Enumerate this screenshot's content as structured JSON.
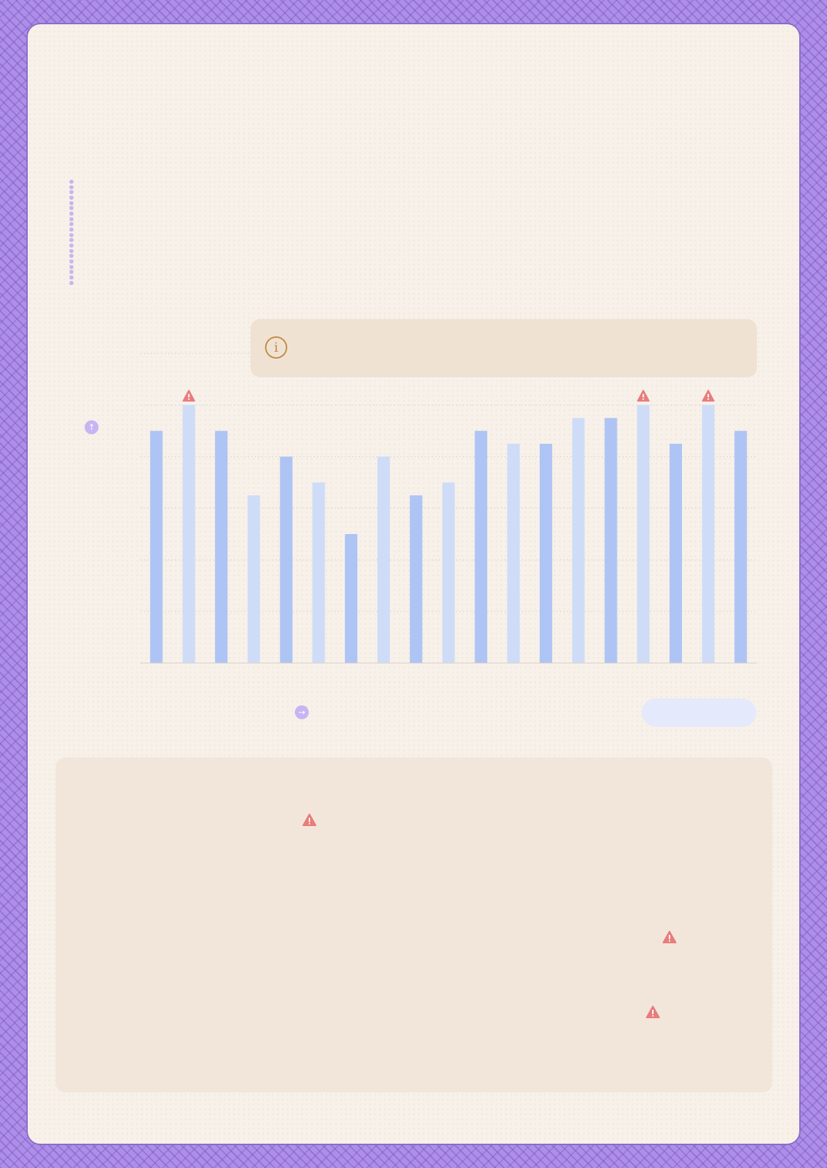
{
  "chart_data": {
    "type": "bar",
    "title": "",
    "xlabel": "",
    "ylabel": "",
    "categories": [
      "",
      "",
      "",
      "",
      "",
      "",
      "",
      "",
      "",
      "",
      "",
      "",
      "",
      "",
      "",
      "",
      "",
      "",
      ""
    ],
    "values": [
      18,
      20,
      18,
      13,
      16,
      14,
      10,
      16,
      13,
      14,
      18,
      17,
      17,
      19,
      19,
      20,
      17,
      20,
      18
    ],
    "flagged_indices": [
      1,
      15,
      17
    ],
    "ylim": [
      0,
      20
    ],
    "grid": true,
    "colors": {
      "bar_primary": "#aec4f4",
      "bar_alternate": "#cfdcf8",
      "warning": "#e77d7c",
      "axis": "#d8cfc6",
      "gridline": "#ddd2c6"
    }
  },
  "info_box": {
    "text": ""
  },
  "action_pill": {
    "label": ""
  },
  "icons": {
    "y_axis": "arrow-up-icon",
    "x_axis": "arrow-right-icon",
    "info": "info-icon",
    "warning": "warning-triangle-icon"
  }
}
